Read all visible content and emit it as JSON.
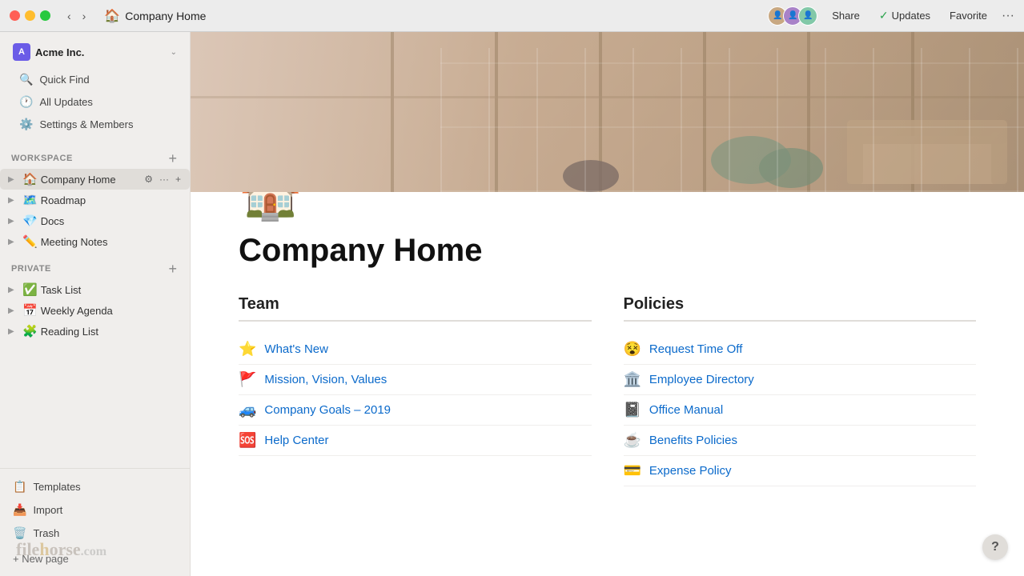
{
  "titlebar": {
    "traffic_lights": [
      "red",
      "yellow",
      "green"
    ],
    "nav_back": "‹",
    "nav_forward": "›",
    "page_icon": "🏠",
    "page_title": "Company Home",
    "share_label": "Share",
    "updates_label": "Updates",
    "favorite_label": "Favorite",
    "more_label": "···"
  },
  "sidebar": {
    "workspace_name": "Acme Inc.",
    "workspace_caret": "⌄",
    "nav_items": [
      {
        "id": "quick-find",
        "icon": "🔍",
        "label": "Quick Find"
      },
      {
        "id": "all-updates",
        "icon": "🕐",
        "label": "All Updates"
      },
      {
        "id": "settings",
        "icon": "⚙️",
        "label": "Settings & Members"
      }
    ],
    "workspace_section_label": "WORKSPACE",
    "workspace_items": [
      {
        "id": "company-home",
        "icon": "🏠",
        "label": "Company Home",
        "active": true
      },
      {
        "id": "roadmap",
        "icon": "🗺️",
        "label": "Roadmap"
      },
      {
        "id": "docs",
        "icon": "💎",
        "label": "Docs"
      },
      {
        "id": "meeting-notes",
        "icon": "✏️",
        "label": "Meeting Notes"
      }
    ],
    "private_section_label": "PRIVATE",
    "private_items": [
      {
        "id": "task-list",
        "icon": "✅",
        "label": "Task List"
      },
      {
        "id": "weekly-agenda",
        "icon": "📅",
        "label": "Weekly Agenda"
      },
      {
        "id": "reading-list",
        "icon": "🧩",
        "label": "Reading List"
      }
    ],
    "bottom_items": [
      {
        "id": "templates",
        "icon": "📋",
        "label": "Templates"
      },
      {
        "id": "import",
        "icon": "📥",
        "label": "Import"
      },
      {
        "id": "trash",
        "icon": "🗑️",
        "label": "Trash"
      }
    ],
    "new_page_label": "+ New page"
  },
  "main": {
    "page_icon": "🏠",
    "page_title": "Company Home",
    "team_section_heading": "Team",
    "team_links": [
      {
        "icon": "⭐",
        "label": "What's New"
      },
      {
        "icon": "🚩",
        "label": "Mission, Vision, Values"
      },
      {
        "icon": "🚙",
        "label": "Company Goals – 2019"
      },
      {
        "icon": "🆘",
        "label": "Help Center"
      }
    ],
    "policies_section_heading": "Policies",
    "policies_links": [
      {
        "icon": "😵",
        "label": "Request Time Off"
      },
      {
        "icon": "🏛️",
        "label": "Employee Directory"
      },
      {
        "icon": "📓",
        "label": "Office Manual"
      },
      {
        "icon": "☕",
        "label": "Benefits Policies"
      },
      {
        "icon": "💳",
        "label": "Expense Policy"
      }
    ]
  },
  "help_btn": "?"
}
